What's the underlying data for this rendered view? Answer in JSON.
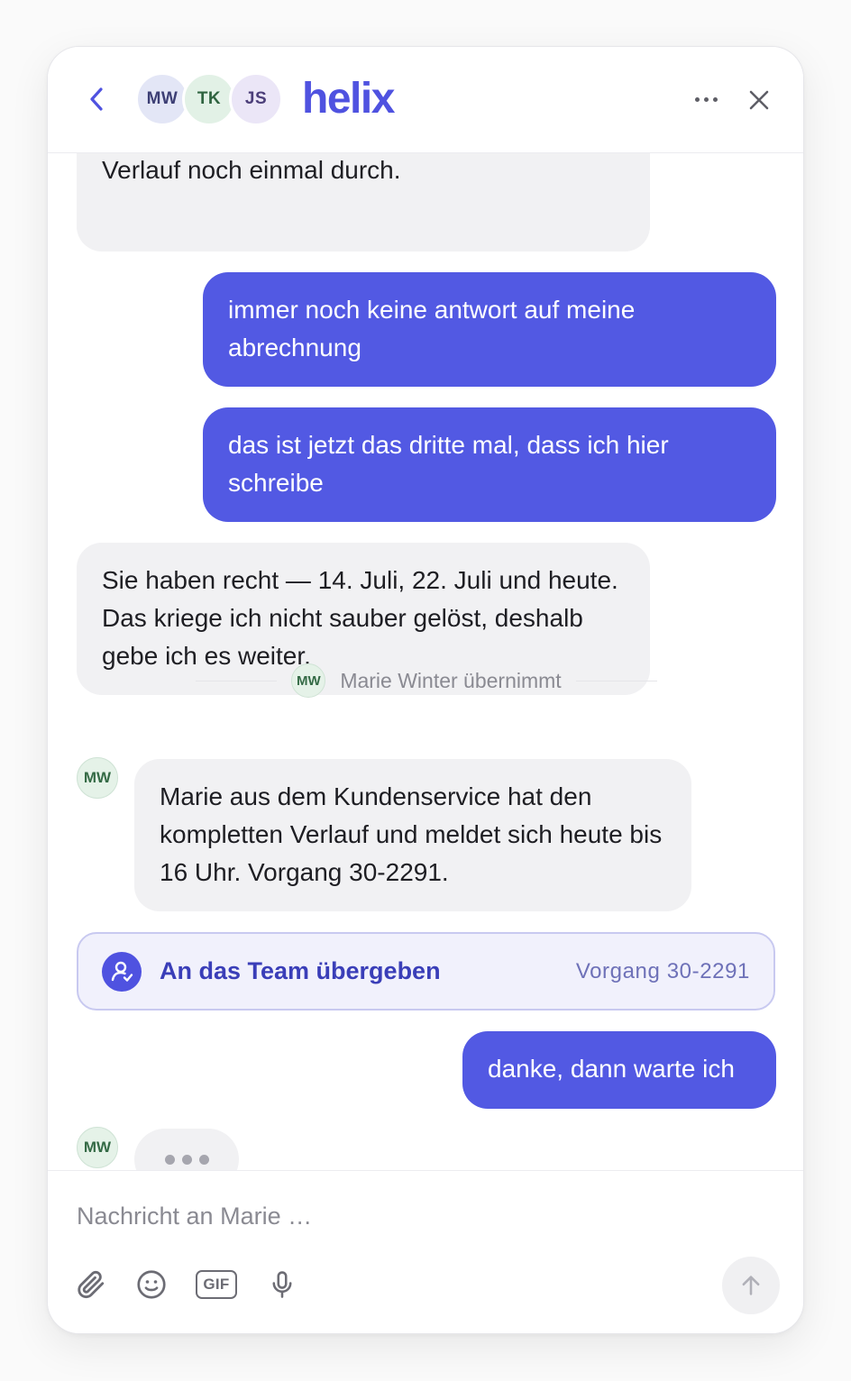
{
  "colors": {
    "brand": "#4f52e0",
    "user_bubble": "#5259e3",
    "bot_bubble": "#f1f1f3",
    "handoff_bg": "#f1f1fc",
    "handoff_border": "#c8c9f0",
    "handoff_title": "#3a3eb8",
    "handoff_ref": "#6e71b8"
  },
  "header": {
    "brand": "helix",
    "avatars": [
      "MW",
      "TK",
      "JS"
    ],
    "icons": {
      "back": "chevron-left-icon",
      "more": "more-horizontal-icon",
      "close": "close-icon"
    }
  },
  "messages": [
    {
      "role": "bot",
      "text": "Verlauf noch einmal durch."
    },
    {
      "role": "user",
      "text": "immer noch keine antwort auf meine abrechnung"
    },
    {
      "role": "user",
      "text": "das ist jetzt das dritte mal, dass ich hier schreibe"
    },
    {
      "role": "bot",
      "text": "Sie haben recht — 14. Juli, 22. Juli und heute. Das kriege ich nicht sauber gelöst, deshalb gebe ich es weiter."
    },
    {
      "role": "agent",
      "avatar": "MW",
      "text": "Marie aus dem Kundenservice hat den kompletten Verlauf und meldet sich heute bis 16 Uhr. Vorgang 30-2291."
    },
    {
      "role": "user",
      "text": "danke, dann warte ich"
    }
  ],
  "handoff_divider": {
    "avatar": "MW",
    "text": "Marie Winter übernimmt"
  },
  "handoff_card": {
    "icon": "user-check-icon",
    "title": "An das Team übergeben",
    "ref": "Vorgang 30-2291"
  },
  "typing": {
    "avatar": "MW"
  },
  "composer": {
    "placeholder": "Nachricht an Marie …",
    "tools": [
      "paperclip-icon",
      "emoji-icon",
      "gif-icon",
      "microphone-icon"
    ],
    "gif_label": "GIF",
    "send_icon": "arrow-up-icon"
  }
}
